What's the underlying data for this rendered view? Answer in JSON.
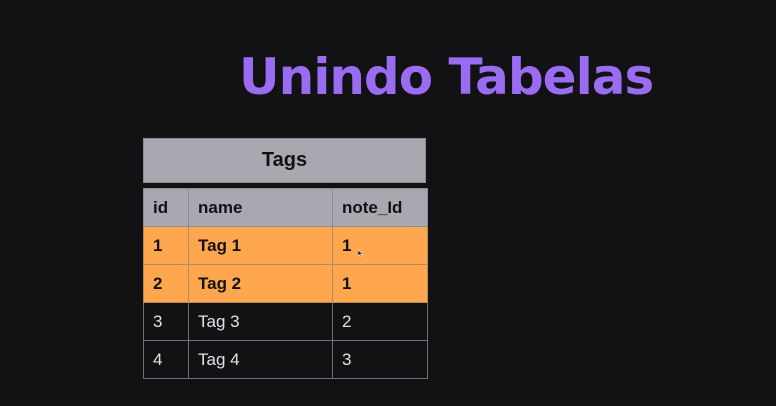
{
  "title": "Unindo Tabelas",
  "table": {
    "caption": "Tags",
    "columns": [
      "id",
      "name",
      "note_Id"
    ],
    "rows": [
      {
        "id": "1",
        "name": "Tag 1",
        "note_id": "1",
        "highlighted": true
      },
      {
        "id": "2",
        "name": "Tag 2",
        "note_id": "1",
        "highlighted": true
      },
      {
        "id": "3",
        "name": "Tag 3",
        "note_id": "2",
        "highlighted": false
      },
      {
        "id": "4",
        "name": "Tag 4",
        "note_id": "3",
        "highlighted": false
      }
    ]
  },
  "colors": {
    "background": "#121214",
    "title": "#9a6cf1",
    "header": "#a8a8b0",
    "highlight": "#ffa74f",
    "text": "#e1e1e6"
  },
  "icons": [
    "mouse-cursor-icon"
  ]
}
